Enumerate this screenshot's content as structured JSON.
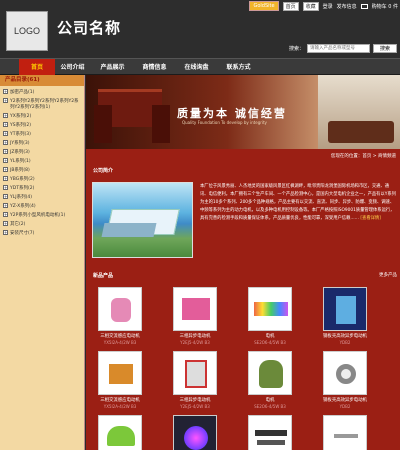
{
  "header": {
    "logo_text": "LOGO",
    "company_name": "公司名称",
    "goldsite": "GoldSite",
    "top_links": [
      "首页",
      "收藏",
      "登录",
      "发布信息",
      "购物车 0 件"
    ],
    "search_label": "搜索：",
    "search_placeholder": "请输入产品名称或型号",
    "search_button": "搜索"
  },
  "nav": {
    "items": [
      "首页",
      "公司介绍",
      "产品展示",
      "商情信息",
      "在线询盘",
      "联系方式"
    ],
    "active": 0
  },
  "sidebar": {
    "title": "产品目录(61)",
    "items": [
      "加密产品(1)",
      "Y2系列Y2系列Y2系列Y2系列Y2系列Y2系列Y2系列(1)",
      "YX系列(2)",
      "YS系列(2)",
      "YT系列(3)",
      "JY系列(3)",
      "JZ系列(3)",
      "YL系列(1)",
      "JB系列(8)",
      "YBG系列(2)",
      "YDT系列(2)",
      "YLJ系列(4)",
      "YZ-X系列(4)",
      "Y2P系列小型风机电动机(1)",
      "其它(2)",
      "安装尺寸(7)"
    ]
  },
  "banner": {
    "slogan": "质量为本  诚信经营",
    "subtitle": "Quality Foundation To develop by integrity"
  },
  "breadcrumb": "您现在的位置：首页 > 商情频道",
  "intro": {
    "title": "公司简介",
    "text": "本厂位于风景秀丽、人杰地灵的国家级风景区红枫湖畔，毗邻贵阳龙洞堡国际机场和市区，交通、通讯、电信便利。本厂拥有三个生产车间、一个产品检测中心，是国内大型电机企业之一，产品有以Y系列为主的10多个系列、200多个品种规格，产品主要有以交流、直流、同步、异步、防爆、变频、调速、中频等系列为主的动力电机，以及多种电机用控制设备等。本厂严格按照ISO9001质量管理体系运行，具有完善的检测手段和质量保证体系，产品质量优良，性能可靠，深受用户信赖……",
    "more": "[查看详情]"
  },
  "products": {
    "title": "新品产品",
    "more": "更多产品",
    "items": [
      {
        "name": "三相交流感应电动机",
        "model": "YX5I2A-4/2W B3"
      },
      {
        "name": "三相异步电动机",
        "model": "Y2EJ5-4/2W B3"
      },
      {
        "name": "电机",
        "model": "SE2O6-4/5W B3"
      },
      {
        "name": "钢板壳高效异步电动机",
        "model": "YDB2"
      },
      {
        "name": "三相交流感应电动机",
        "model": "YX5I2A-4/2W B3"
      },
      {
        "name": "三相异步电动机",
        "model": "Y2EJ5-4/2W B3"
      },
      {
        "name": "电机",
        "model": "SE2O6-4/5W B3"
      },
      {
        "name": "钢板壳高效异步电动机",
        "model": "YDB2"
      },
      {
        "name": "",
        "model": ""
      },
      {
        "name": "",
        "model": ""
      },
      {
        "name": "",
        "model": ""
      },
      {
        "name": "",
        "model": ""
      }
    ]
  },
  "colors": {
    "brand_red": "#9b1f14",
    "nav_active": "#c11f10",
    "sidebar_bg": "#f3d9a3",
    "header_bg": "#2d2d2d"
  }
}
